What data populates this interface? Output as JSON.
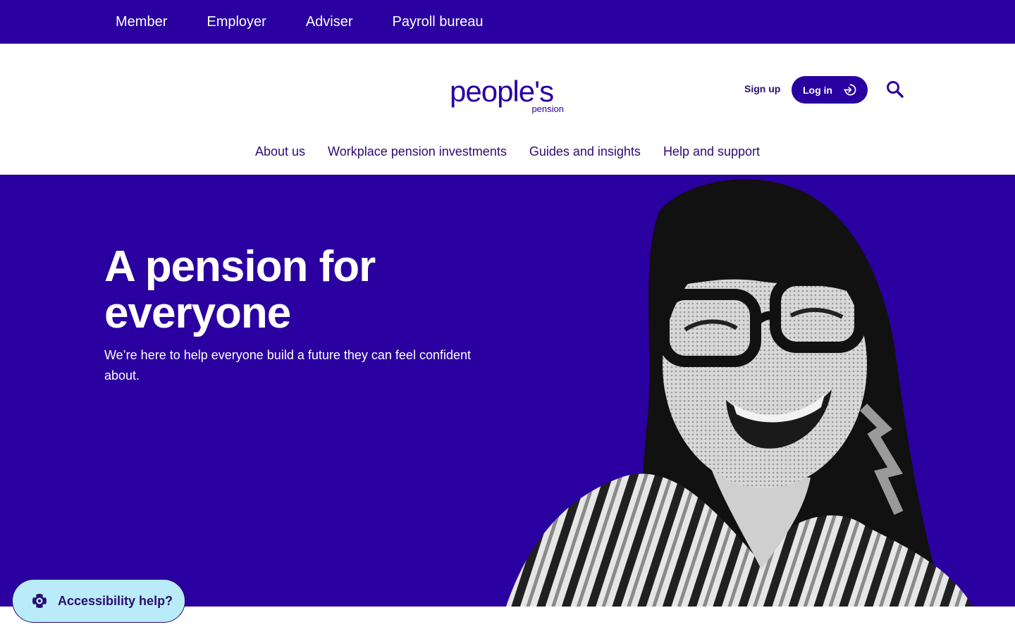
{
  "topbar": {
    "links": [
      "Member",
      "Employer",
      "Adviser",
      "Payroll bureau"
    ]
  },
  "header": {
    "logo": {
      "main": "people's",
      "sub": "pension"
    },
    "signup_label": "Sign up",
    "login_label": "Log in",
    "icons": {
      "login": "login-arrow-icon",
      "search": "search-icon"
    }
  },
  "main_nav": {
    "items": [
      "About us",
      "Workplace pension investments",
      "Guides and insights",
      "Help and support"
    ]
  },
  "hero": {
    "title": "A pension for everyone",
    "subtitle": "We’re here to help everyone build a future they can feel confident about.",
    "image": "smiling-person-with-glasses-photo"
  },
  "accessibility": {
    "label": "Accessibility help?",
    "icon": "lifebuoy-icon"
  },
  "colors": {
    "brand": "#2a00a0",
    "nav_text": "#2a0c72",
    "accessibility_bg": "#b9ecf8"
  }
}
